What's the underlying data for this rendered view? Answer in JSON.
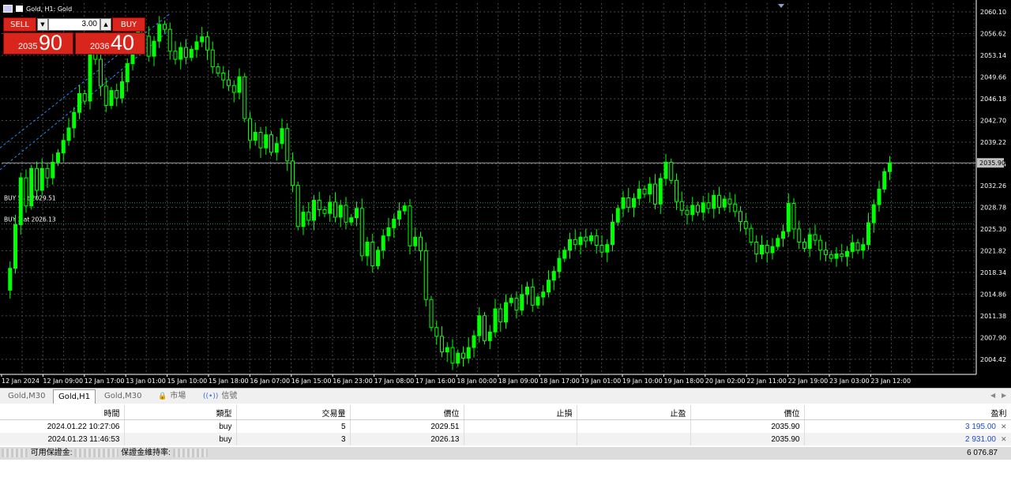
{
  "window": {
    "title": "Gold, H1:  Gold"
  },
  "trade_panel": {
    "sell_label": "SELL",
    "buy_label": "BUY",
    "lot_value": "3.00",
    "sell_price_prefix": "2035",
    "sell_price_big": "90",
    "buy_price_prefix": "2036",
    "buy_price_big": "40"
  },
  "chart": {
    "price_min": 2002.0,
    "price_max": 2061.5,
    "bid": 2035.9,
    "bid_label": "2035.90",
    "y_ticks": [
      "2060.10",
      "2056.62",
      "2053.14",
      "2049.66",
      "2046.18",
      "2042.70",
      "2039.22",
      "2035.74",
      "2032.26",
      "2028.78",
      "2025.30",
      "2021.82",
      "2018.34",
      "2014.86",
      "2011.38",
      "2007.90",
      "2004.42"
    ],
    "x_ticks": [
      "12 Jan 2024",
      "12 Jan 09:00",
      "12 Jan 17:00",
      "13 Jan 01:00",
      "15 Jan 10:00",
      "15 Jan 18:00",
      "16 Jan 07:00",
      "16 Jan 15:00",
      "16 Jan 23:00",
      "17 Jan 08:00",
      "17 Jan 16:00",
      "18 Jan 00:00",
      "18 Jan 09:00",
      "18 Jan 17:00",
      "19 Jan 01:00",
      "19 Jan 10:00",
      "19 Jan 18:00",
      "20 Jan 02:00",
      "22 Jan 11:00",
      "22 Jan 19:00",
      "23 Jan 03:00",
      "23 Jan 12:00"
    ],
    "positions": [
      {
        "label": "BUY 5 at 2029.51",
        "price": 2029.51
      },
      {
        "label": "BUY 3 at 2026.13",
        "price": 2026.13
      }
    ],
    "colors": {
      "background": "#000000",
      "grid": "#4a4a4a",
      "bull": "#00ff00",
      "bear": "#000000",
      "bid_line": "#a0a0a0",
      "position_line": "#2e8b57",
      "trend_line": "#1e90ff"
    },
    "closes": [
      2015.5,
      2019,
      2026,
      2033.5,
      2029,
      2035,
      2031.5,
      2035,
      2033.5,
      2036,
      2037.5,
      2039.5,
      2041.5,
      2044,
      2047,
      2045.8,
      2055.2,
      2052.5,
      2048.2,
      2045.1,
      2047.5,
      2046.3,
      2048.9,
      2051.8,
      2054.6,
      2058,
      2056.2,
      2053,
      2055.4,
      2058.1,
      2057.3,
      2053.8,
      2052.5,
      2054.4,
      2052.8,
      2054.1,
      2055.3,
      2056.1,
      2054,
      2051.3,
      2050.3,
      2049.2,
      2048.3,
      2047.2,
      2049.7,
      2043,
      2039.5,
      2040.8,
      2038.3,
      2040.4,
      2037.6,
      2039,
      2041.4,
      2036.2,
      2032.3,
      2025.7,
      2028,
      2026.7,
      2029.9,
      2028.4,
      2027.8,
      2029.6,
      2027.2,
      2029.1,
      2026.4,
      2027.1,
      2028.6,
      2021,
      2023.2,
      2019.4,
      2021.9,
      2024.2,
      2025.5,
      2026.9,
      2028.2,
      2029,
      2022.6,
      2024,
      2021.8,
      2014,
      2009.5,
      2008.1,
      2005.6,
      2006.3,
      2003.8,
      2005.4,
      2004.6,
      2006.3,
      2008.2,
      2011.4,
      2007.4,
      2008.8,
      2012.5,
      2010.4,
      2013.5,
      2014.2,
      2012.3,
      2014.8,
      2016,
      2013.1,
      2014.4,
      2015.2,
      2017.1,
      2018.5,
      2020.6,
      2021.9,
      2023.6,
      2022.8,
      2024,
      2023.4,
      2024.2,
      2022.7,
      2021.6,
      2022.8,
      2026.4,
      2028.6,
      2030.3,
      2028.8,
      2030.2,
      2031.7,
      2030.9,
      2032.5,
      2029.3,
      2033.4,
      2036,
      2033.1,
      2029.7,
      2028.3,
      2027.6,
      2029.1,
      2028,
      2029.5,
      2028.6,
      2030.7,
      2028.8,
      2030.1,
      2029.3,
      2028.1,
      2026.5,
      2025.4,
      2023.2,
      2021.3,
      2022.7,
      2021.5,
      2022.5,
      2023.8,
      2024.9,
      2029.4,
      2025.3,
      2023.2,
      2022.2,
      2024.4,
      2023.5,
      2021.9,
      2021.2,
      2020.6,
      2021.3,
      2020.9,
      2021.7,
      2023.1,
      2021.9,
      2022.8,
      2026.3,
      2029.2,
      2031.7,
      2034.5,
      2035.9
    ],
    "candles_start_x": 6,
    "candle_step": 6.75
  },
  "tabs": [
    {
      "label": "Gold,M30",
      "active": false
    },
    {
      "label": "Gold,H1",
      "active": true
    },
    {
      "label": "Gold,M30",
      "active": false
    },
    {
      "label": "市場",
      "active": false,
      "icon": "lock-icon"
    },
    {
      "label": "信號",
      "active": false,
      "icon": "signal-icon"
    }
  ],
  "table": {
    "headers": [
      "時間",
      "類型",
      "交易量",
      "價位",
      "止損",
      "止盈",
      "價位",
      "盈利"
    ],
    "rows": [
      {
        "time": "2024.01.22 10:27:06",
        "type": "buy",
        "volume": "5",
        "open_price": "2029.51",
        "sl": "",
        "tp": "",
        "price": "2035.90",
        "profit": "3 195.00"
      },
      {
        "time": "2024.01.23 11:46:53",
        "type": "buy",
        "volume": "3",
        "open_price": "2026.13",
        "sl": "",
        "tp": "",
        "price": "2035.90",
        "profit": "2 931.00"
      }
    ],
    "summary": {
      "free_margin_label": "可用保證金:",
      "margin_level_label": "保證金維持率:",
      "total_profit": "6 076.87"
    }
  }
}
